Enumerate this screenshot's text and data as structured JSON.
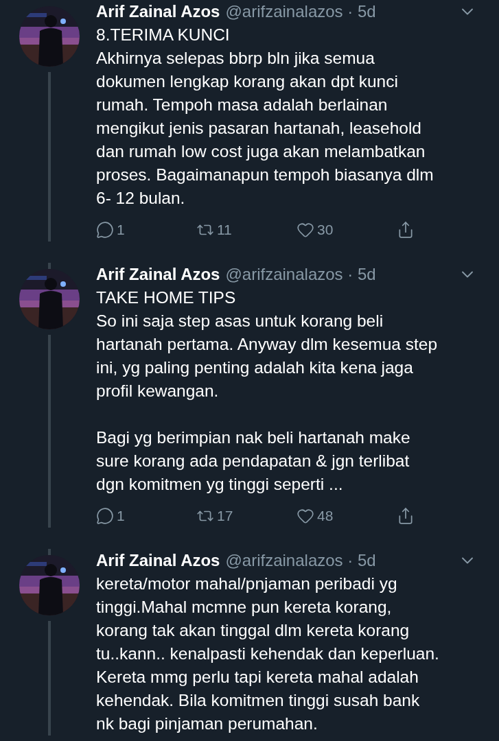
{
  "tweets": [
    {
      "name": "Arif Zainal Azos",
      "meta": "@arifzainalazos · 5d",
      "paragraphs": [
        [
          "8.TERIMA KUNCI",
          "Akhirnya selepas bbrp bln jika semua",
          "dokumen lengkap korang akan dpt kunci",
          "rumah. Tempoh masa adalah berlainan",
          "mengikut jenis pasaran hartanah, leasehold",
          "dan rumah low cost juga akan melambatkan",
          "proses. Bagaimanapun tempoh biasanya dlm",
          "6- 12 bulan."
        ]
      ],
      "replies": "1",
      "retweets": "11",
      "likes": "30"
    },
    {
      "name": "Arif Zainal Azos",
      "meta": "@arifzainalazos · 5d",
      "paragraphs": [
        [
          "TAKE HOME TIPS",
          "So ini saja step asas untuk korang beli",
          "hartanah pertama. Anyway dlm kesemua step",
          "ini, yg paling penting adalah kita kena jaga",
          "profil kewangan."
        ],
        [
          "Bagi yg berimpian nak beli hartanah make",
          "sure korang ada pendapatan & jgn terlibat",
          "dgn komitmen yg tinggi seperti ..."
        ]
      ],
      "replies": "1",
      "retweets": "17",
      "likes": "48"
    },
    {
      "name": "Arif Zainal Azos",
      "meta": "@arifzainalazos · 5d",
      "paragraphs": [
        [
          "kereta/motor mahal/pnjaman peribadi yg",
          "tinggi.Mahal mcmne pun kereta korang,",
          "korang tak akan tinggal dlm kereta korang",
          "tu..kann.. kenalpasti kehendak dan keperluan.",
          "Kereta mmg perlu tapi kereta mahal adalah",
          "kehendak. Bila komitmen tinggi susah bank",
          "nk bagi pinjaman perumahan."
        ]
      ]
    }
  ]
}
